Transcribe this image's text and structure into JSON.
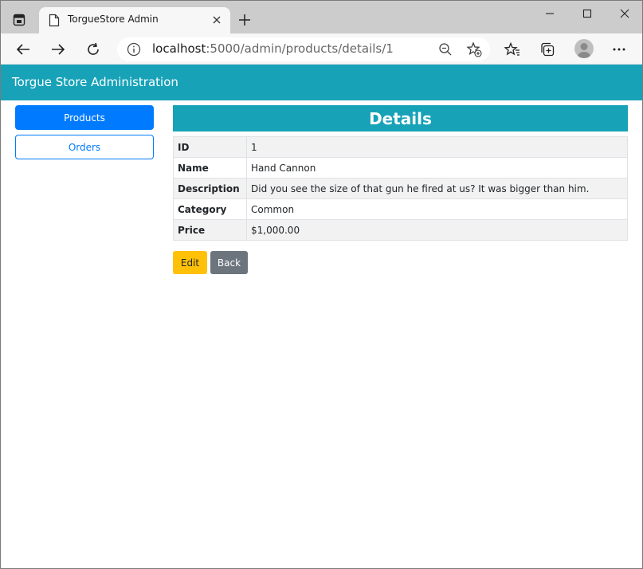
{
  "browser": {
    "tab_title": "TorgueStore Admin",
    "url_host": "localhost",
    "url_rest": ":5000/admin/products/details/1",
    "icons": [
      "window-menu-icon",
      "page-icon",
      "close-icon",
      "plus-icon",
      "minimize-icon",
      "maximize-icon",
      "close-window-icon",
      "back-arrow-icon",
      "forward-arrow-icon",
      "refresh-icon",
      "info-icon",
      "zoom-out-icon",
      "add-favorite-icon",
      "favorites-icon",
      "collections-icon",
      "profile-avatar-icon",
      "more-icon"
    ]
  },
  "app": {
    "brand": "Torgue Store Administration",
    "colors": {
      "navbar": "#17a2b8",
      "primary": "#007bff",
      "warning": "#ffc107",
      "secondary": "#6c757d"
    }
  },
  "sidebar": {
    "products_label": "Products",
    "orders_label": "Orders"
  },
  "details": {
    "heading": "Details",
    "rows": [
      {
        "label": "ID",
        "value": "1"
      },
      {
        "label": "Name",
        "value": "Hand Cannon"
      },
      {
        "label": "Description",
        "value": "Did you see the size of that gun he fired at us? It was bigger than him."
      },
      {
        "label": "Category",
        "value": "Common"
      },
      {
        "label": "Price",
        "value": "$1,000.00"
      }
    ]
  },
  "actions": {
    "edit_label": "Edit",
    "back_label": "Back"
  }
}
